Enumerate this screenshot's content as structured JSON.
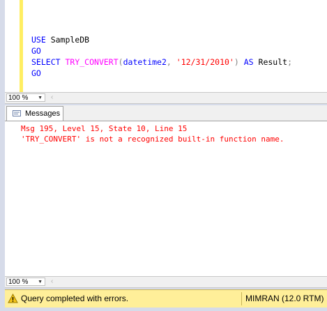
{
  "editor": {
    "lines": [
      [
        {
          "t": "USE",
          "c": "kw"
        },
        {
          "t": " SampleDB",
          "c": ""
        }
      ],
      [
        {
          "t": "GO",
          "c": "kw"
        }
      ],
      [
        {
          "t": "SELECT",
          "c": "kw"
        },
        {
          "t": " ",
          "c": ""
        },
        {
          "t": "TRY_CONVERT",
          "c": "fn"
        },
        {
          "t": "(",
          "c": "op"
        },
        {
          "t": "datetime2",
          "c": "kw"
        },
        {
          "t": ", ",
          "c": "op"
        },
        {
          "t": "'12/31/2010'",
          "c": "str"
        },
        {
          "t": ")",
          "c": "op"
        },
        {
          "t": " ",
          "c": ""
        },
        {
          "t": "AS",
          "c": "kw"
        },
        {
          "t": " Result",
          "c": ""
        },
        {
          "t": ";",
          "c": "op"
        }
      ],
      [
        {
          "t": "GO",
          "c": "kw"
        }
      ]
    ]
  },
  "editor_zoom": {
    "value": "100 %"
  },
  "results": {
    "tab_label": "Messages",
    "messages": [
      "Msg 195, Level 15, State 10, Line 15",
      "'TRY_CONVERT' is not a recognized built-in function name."
    ]
  },
  "results_zoom": {
    "value": "100 %"
  },
  "status": {
    "message": "Query completed with errors.",
    "server": "MIMRAN (12.0 RTM)"
  }
}
